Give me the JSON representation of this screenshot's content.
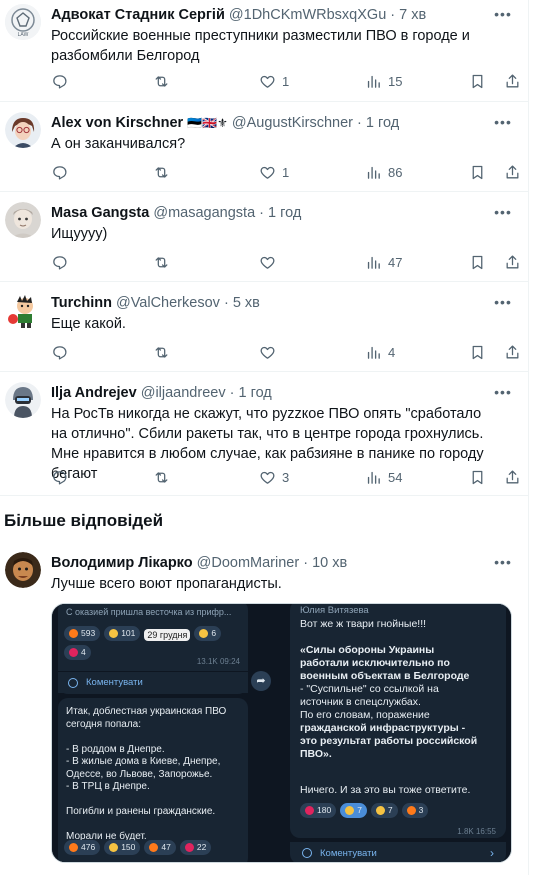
{
  "tweets": [
    {
      "name": "Адвокат Стадник Сергій",
      "handle": "@1DhCKmWRbsxqXGu",
      "time": "7 хв",
      "text": "Российские военные преступники разместили ПВО в городе и разбомбили Белгород",
      "replies": "",
      "retweets": "",
      "likes": "1",
      "views": "15"
    },
    {
      "name": "Alex von Kirschner",
      "name_flags": "🇪🇪🇬🇧⚜",
      "handle": "@AugustKirschner",
      "time": "1 год",
      "text": "А он заканчивался?",
      "replies": "",
      "retweets": "",
      "likes": "1",
      "views": "86"
    },
    {
      "name": "Masa Gangsta",
      "handle": "@masagangsta",
      "time": "1 год",
      "text": "Ищуууу)",
      "replies": "",
      "retweets": "",
      "likes": "",
      "views": "47"
    },
    {
      "name": "Turchinn",
      "handle": "@ValCherkesov",
      "time": "5 хв",
      "text": "Еще какой.",
      "replies": "",
      "retweets": "",
      "likes": "",
      "views": "4"
    },
    {
      "name": "Ilja Andrejev",
      "handle": "@iljaandreev",
      "time": "1 год",
      "text": "На РосТв никогда не скажут, что руzzкое ПВО опять \"сработало на отлично\". Сбили ракеты так, что в центре города грохнулись. Мне нравится в любом случае, как рабзияне в панике по городу бегают",
      "replies": "",
      "retweets": "",
      "likes": "3",
      "views": "54"
    }
  ],
  "section_title": "Більше відповідей",
  "bottom_tweet": {
    "name": "Володимир Лікарко",
    "handle": "@DoomMariner",
    "time": "10 хв",
    "text": "Лучше всего воют пропагандисты."
  },
  "media": {
    "left": {
      "top_snippet": "С оказией пришла весточка из прифр...",
      "reactions_top": [
        {
          "emoji": "🔥",
          "count": "593"
        },
        {
          "emoji": "👍",
          "count": "101"
        },
        {
          "emoji": "",
          "count": "29 грудня"
        },
        {
          "emoji": "😆",
          "count": "6"
        }
      ],
      "heart_count": "4",
      "views_time": "13.1K 09:24",
      "comments_label": "Коментувати",
      "body": [
        "Итак, доблестная украинская ПВО",
        "сегодня попала:",
        "",
        "- В роддом в Днепре.",
        "- В жилые дома в Киеве, Днепре,",
        "Одессе, во Львове, Запорожье.",
        "- В ТРЦ в Днепре.",
        "",
        "Погибли и ранены гражданские.",
        "",
        "Морали не будет."
      ],
      "reactions_bottom": [
        {
          "emoji": "🔥",
          "count": "476"
        },
        {
          "emoji": "🤣",
          "count": "150"
        },
        {
          "emoji": "🔥",
          "count": "47"
        },
        {
          "emoji": "😡",
          "count": "22"
        }
      ]
    },
    "right": {
      "author": "Юлия Витязева",
      "line1": "Вот же ж твари гнойные!!!",
      "quote": [
        {
          "t": "«Силы обороны Украины",
          "b": true
        },
        {
          "t": "работали исключительно по",
          "b": true
        },
        {
          "t": "военным объектам в Белгороде",
          "b": true
        },
        {
          "t": "- \"Суспильне\" со ссылкой на",
          "b": false
        },
        {
          "t": "источник в спецслужбах.",
          "b": false
        },
        {
          "t": "По его словам, поражение",
          "b": false,
          "bold_tail": "поражение"
        },
        {
          "t": "гражданской инфраструктуры -",
          "b": true
        },
        {
          "t": "это результат работы российской",
          "b": true
        },
        {
          "t": "ПВО».",
          "b": true
        }
      ],
      "closing": "Ничего. И за это вы тоже ответите.",
      "reactions": [
        {
          "emoji": "😡",
          "count": "180"
        },
        {
          "emoji": "😁",
          "count": "7"
        },
        {
          "emoji": "👍",
          "count": "7"
        },
        {
          "emoji": "🔥",
          "count": "3"
        }
      ],
      "views_time": "1.8K 16:55",
      "comments_label": "Коментувати"
    }
  },
  "colors": {
    "text": "#0f1419",
    "secondary": "#536471",
    "divider": "#eff3f4",
    "tg_bg": "#0e1621",
    "tg_bubble": "#182533",
    "tg_link": "#79b4ee"
  },
  "icons": [
    "reply-icon",
    "retweet-icon",
    "like-icon",
    "views-icon",
    "bookmark-icon",
    "share-icon",
    "more-icon",
    "chevron-right-icon",
    "forward-icon",
    "comment-icon"
  ]
}
